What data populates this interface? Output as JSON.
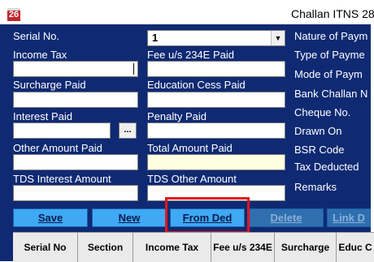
{
  "window": {
    "icon_text": "26",
    "title": "Challan ITNS 28"
  },
  "form": {
    "serial_label": "Serial No.",
    "serial_value": "1",
    "income_tax_label": "Income Tax",
    "fee_234e_label": "Fee u/s 234E Paid",
    "surcharge_label": "Surcharge Paid",
    "education_cess_label": "Education Cess Paid",
    "interest_label": "Interest Paid",
    "penalty_label": "Penalty Paid",
    "other_amount_label": "Other Amount Paid",
    "total_amount_label": "Total Amount Paid",
    "tds_interest_label": "TDS Interest Amount",
    "tds_other_label": "TDS Other Amount",
    "dots_label": "...",
    "right_labels": {
      "nature": "Nature of Paym",
      "type": "Type of Payme",
      "mode": "Mode of Paym",
      "bank_challan": "Bank Challan N",
      "cheque": "Cheque No.",
      "drawn_on": "Drawn On",
      "bsr": "BSR Code",
      "tax_deducted": "Tax Deducted",
      "remarks": "Remarks"
    }
  },
  "buttons": {
    "save": "Save",
    "new": "New",
    "from_ded": "From Ded",
    "delete": "Delete",
    "link_ded": "Link D"
  },
  "table": {
    "columns": [
      "Serial No",
      "Section",
      "Income Tax",
      "Fee u/s 234E",
      "Surcharge",
      "Educ C"
    ]
  },
  "colors": {
    "form_background": "#0f2a73",
    "button": "#3fa9f5",
    "highlight": "#e0161d"
  }
}
